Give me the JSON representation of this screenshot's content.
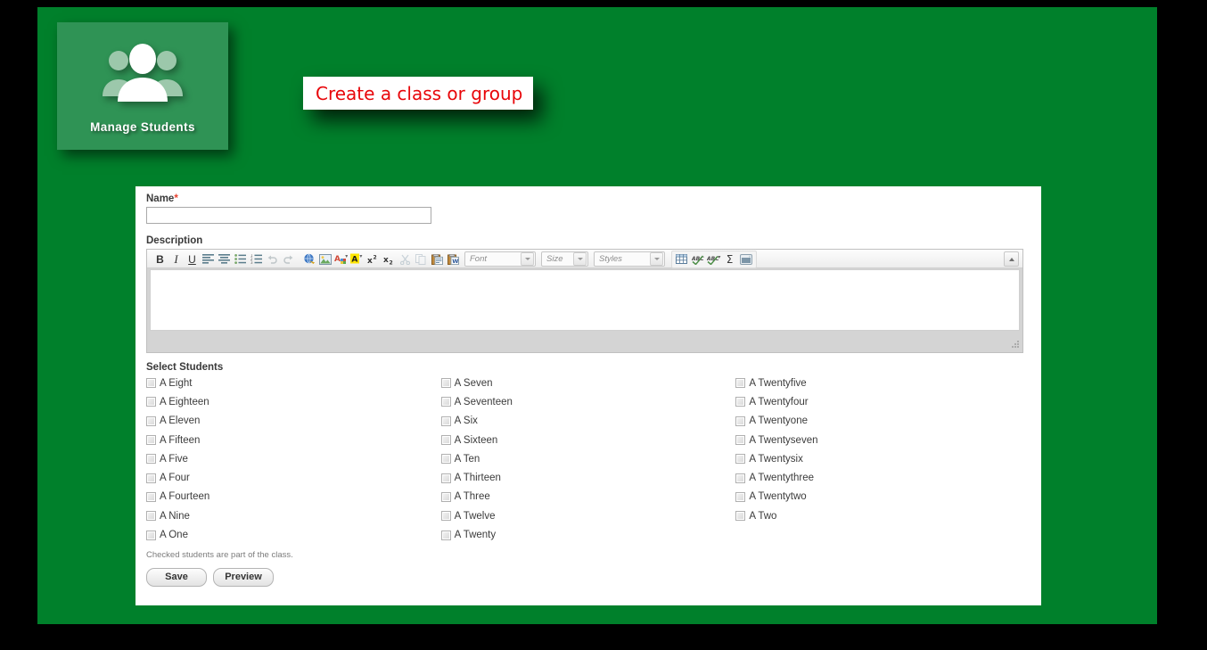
{
  "tile": {
    "label": "Manage  Students",
    "icon": "people-group-icon",
    "bg_color": "#2f9355"
  },
  "tooltip": {
    "text": "Create a class or group",
    "text_color": "#e8060a"
  },
  "stage": {
    "bg_color": "#00802b"
  },
  "form": {
    "name": {
      "label": "Name",
      "required_marker": "*",
      "value": "",
      "placeholder": ""
    },
    "description": {
      "label": "Description",
      "value": "",
      "toolbar": {
        "bold": "B",
        "italic": "I",
        "underline": "U",
        "font_placeholder": "Font",
        "size_placeholder": "Size",
        "styles_placeholder": "Styles",
        "buttons": [
          "bold-icon",
          "italic-icon",
          "underline-icon",
          "align-left-icon",
          "align-center-icon",
          "bulleted-list-icon",
          "numbered-list-icon",
          "undo-icon",
          "redo-icon",
          "link-icon",
          "image-icon",
          "text-color-icon",
          "highlight-color-icon",
          "superscript-icon",
          "subscript-icon",
          "cut-icon",
          "copy-icon",
          "paste-icon",
          "paste-from-word-icon",
          "table-icon",
          "spellcheck-icon",
          "spellcheck-options-icon",
          "special-character-icon",
          "maximize-icon"
        ],
        "collapse": "collapse-toolbar-icon"
      }
    },
    "students": {
      "label": "Select Students",
      "note": "Checked students are part of the class.",
      "columns": [
        [
          {
            "label": "A Eight",
            "checked": false
          },
          {
            "label": "A Eighteen",
            "checked": false
          },
          {
            "label": "A Eleven",
            "checked": false
          },
          {
            "label": "A Fifteen",
            "checked": false
          },
          {
            "label": "A Five",
            "checked": false
          },
          {
            "label": "A Four",
            "checked": false
          },
          {
            "label": "A Fourteen",
            "checked": false
          },
          {
            "label": "A Nine",
            "checked": false
          },
          {
            "label": "A One",
            "checked": false
          }
        ],
        [
          {
            "label": "A Seven",
            "checked": false
          },
          {
            "label": "A Seventeen",
            "checked": false
          },
          {
            "label": "A Six",
            "checked": false
          },
          {
            "label": "A Sixteen",
            "checked": false
          },
          {
            "label": "A Ten",
            "checked": false
          },
          {
            "label": "A Thirteen",
            "checked": false
          },
          {
            "label": "A Three",
            "checked": false
          },
          {
            "label": "A Twelve",
            "checked": false
          },
          {
            "label": "A Twenty",
            "checked": false
          }
        ],
        [
          {
            "label": "A Twentyfive",
            "checked": false
          },
          {
            "label": "A Twentyfour",
            "checked": false
          },
          {
            "label": "A Twentyone",
            "checked": false
          },
          {
            "label": "A Twentyseven",
            "checked": false
          },
          {
            "label": "A Twentysix",
            "checked": false
          },
          {
            "label": "A Twentythree",
            "checked": false
          },
          {
            "label": "A Twentytwo",
            "checked": false
          },
          {
            "label": "A Two",
            "checked": false
          }
        ]
      ]
    },
    "actions": {
      "save_label": "Save",
      "preview_label": "Preview"
    }
  }
}
